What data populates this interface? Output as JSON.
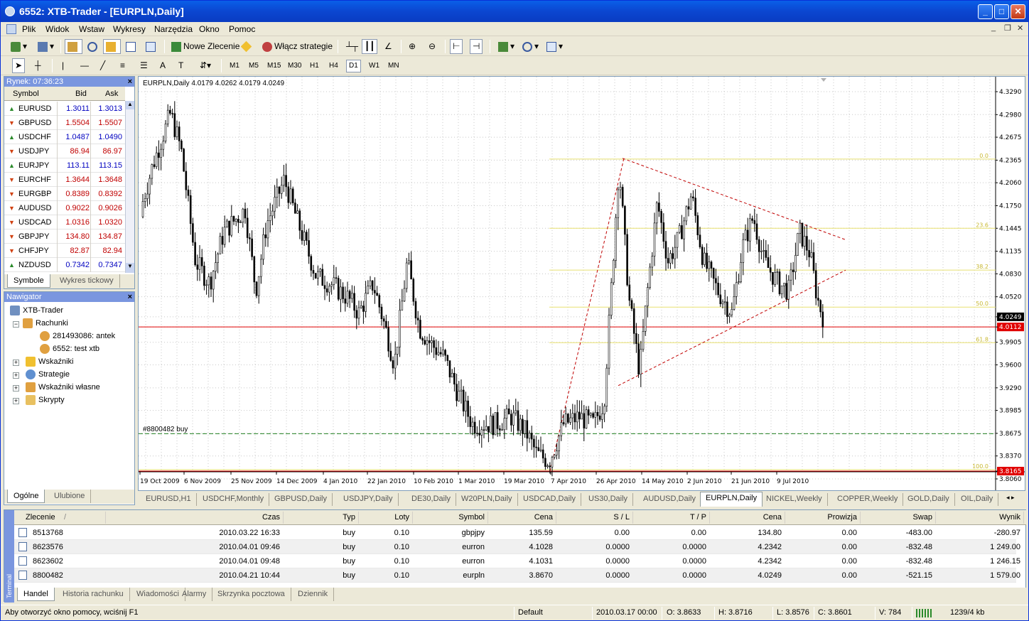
{
  "window": {
    "title": "6552: XTB-Trader - [EURPLN,Daily]"
  },
  "menu": [
    "Plik",
    "Widok",
    "Wstaw",
    "Wykresy",
    "Narzędzia",
    "Okno",
    "Pomoc"
  ],
  "toolbar": {
    "new_order": "Nowe Zlecenie",
    "enable_strategies": "Włącz strategie"
  },
  "timeframes": [
    "M1",
    "M5",
    "M15",
    "M30",
    "H1",
    "H4",
    "D1",
    "W1",
    "MN"
  ],
  "active_timeframe": "D1",
  "market_watch": {
    "title": "Rynek: 07:36:23",
    "col_symbol": "Symbol",
    "col_bid": "Bid",
    "col_ask": "Ask",
    "rows": [
      {
        "symbol": "EURUSD",
        "bid": "1.3011",
        "ask": "1.3013",
        "dir": "up",
        "color": "#0000c0"
      },
      {
        "symbol": "GBPUSD",
        "bid": "1.5504",
        "ask": "1.5507",
        "dir": "down",
        "color": "#c00000"
      },
      {
        "symbol": "USDCHF",
        "bid": "1.0487",
        "ask": "1.0490",
        "dir": "up",
        "color": "#0000c0"
      },
      {
        "symbol": "USDJPY",
        "bid": "86.94",
        "ask": "86.97",
        "dir": "down",
        "color": "#c00000"
      },
      {
        "symbol": "EURJPY",
        "bid": "113.11",
        "ask": "113.15",
        "dir": "up",
        "color": "#0000c0"
      },
      {
        "symbol": "EURCHF",
        "bid": "1.3644",
        "ask": "1.3648",
        "dir": "down",
        "color": "#c00000"
      },
      {
        "symbol": "EURGBP",
        "bid": "0.8389",
        "ask": "0.8392",
        "dir": "down",
        "color": "#c00000"
      },
      {
        "symbol": "AUDUSD",
        "bid": "0.9022",
        "ask": "0.9026",
        "dir": "down",
        "color": "#c00000"
      },
      {
        "symbol": "USDCAD",
        "bid": "1.0316",
        "ask": "1.0320",
        "dir": "down",
        "color": "#c00000"
      },
      {
        "symbol": "GBPJPY",
        "bid": "134.80",
        "ask": "134.87",
        "dir": "down",
        "color": "#c00000"
      },
      {
        "symbol": "CHFJPY",
        "bid": "82.87",
        "ask": "82.94",
        "dir": "down",
        "color": "#c00000"
      },
      {
        "symbol": "NZDUSD",
        "bid": "0.7342",
        "ask": "0.7347",
        "dir": "up",
        "color": "#0000c0"
      }
    ],
    "tabs": [
      "Symbole",
      "Wykres tickowy"
    ]
  },
  "navigator": {
    "title": "Nawigator",
    "root": "XTB-Trader",
    "accounts": "Rachunki",
    "acc1": "281493086: antek",
    "acc2": "6552: test xtb",
    "items": [
      "Wskaźniki",
      "Strategie",
      "Wskaźniki własne",
      "Skrypty"
    ],
    "tabs": [
      "Ogólne",
      "Ulubione"
    ]
  },
  "chart": {
    "header": "EURPLN,Daily  4.0179 4.0262 4.0179 4.0249",
    "order_label": "#8800482 buy",
    "current_price": "4.0249",
    "red_price": "4.0112",
    "low_price": "3.8165",
    "price_ticks": [
      "4.3290",
      "4.2980",
      "4.2675",
      "4.2365",
      "4.2060",
      "4.1750",
      "4.1445",
      "4.1135",
      "4.0830",
      "4.0520",
      "4.0249",
      "4.0112",
      "3.9905",
      "3.9600",
      "3.9290",
      "3.8985",
      "3.8675",
      "3.8370",
      "3.8165",
      "3.8060"
    ],
    "date_ticks": [
      "19 Oct 2009",
      "6 Nov 2009",
      "25 Nov 2009",
      "14 Dec 2009",
      "4 Jan 2010",
      "22 Jan 2010",
      "10 Feb 2010",
      "1 Mar 2010",
      "19 Mar 2010",
      "7 Apr 2010",
      "26 Apr 2010",
      "14 May 2010",
      "2 Jun 2010",
      "21 Jun 2010",
      "9 Jul 2010"
    ],
    "fib_labels": [
      "0.0",
      "23.6",
      "38.2",
      "50.0",
      "61.8",
      "100.0"
    ],
    "colors": {
      "fib": "#e8e070",
      "trend": "#c00000",
      "red_line": "#e00000",
      "order_line": "#208020",
      "candle": "#000000"
    }
  },
  "chart_tabs": [
    "EURUSD,H1",
    "USDCHF,Monthly",
    "GBPUSD,Daily",
    "USDJPY,Daily",
    "DE30,Daily",
    "W20PLN,Daily",
    "USDCAD,Daily",
    "US30,Daily",
    "AUDUSD,Daily",
    "EURPLN,Daily",
    "NICKEL,Weekly",
    "COPPER,Weekly",
    "GOLD,Daily",
    "OIL,Daily"
  ],
  "active_chart_tab": "EURPLN,Daily",
  "terminal": {
    "side_label": "Terminal",
    "headers": [
      "Zlecenie",
      "Czas",
      "Typ",
      "Loty",
      "Symbol",
      "Cena",
      "S / L",
      "T / P",
      "Cena",
      "Prowizja",
      "Swap",
      "Wynik"
    ],
    "sort_mark": "/",
    "rows": [
      [
        "8513768",
        "2010.03.22 16:33",
        "buy",
        "0.10",
        "gbpjpy",
        "135.59",
        "0.00",
        "0.00",
        "134.80",
        "0.00",
        "-483.00",
        "-280.97"
      ],
      [
        "8623576",
        "2010.04.01 09:46",
        "buy",
        "0.10",
        "eurron",
        "4.1028",
        "0.0000",
        "0.0000",
        "4.2342",
        "0.00",
        "-832.48",
        "1 249.00"
      ],
      [
        "8623602",
        "2010.04.01 09:48",
        "buy",
        "0.10",
        "eurron",
        "4.1031",
        "0.0000",
        "0.0000",
        "4.2342",
        "0.00",
        "-832.48",
        "1 246.15"
      ],
      [
        "8800482",
        "2010.04.21 10:44",
        "buy",
        "0.10",
        "eurpln",
        "3.8670",
        "0.0000",
        "0.0000",
        "4.0249",
        "0.00",
        "-521.15",
        "1 579.00"
      ]
    ],
    "tabs": [
      "Handel",
      "Historia rachunku",
      "Wiadomości",
      "Alarmy",
      "Skrzynka pocztowa",
      "Dziennik"
    ]
  },
  "status": {
    "help": "Aby otworzyć okno pomocy, wciśnij F1",
    "profile": "Default",
    "date": "2010.03.17 00:00",
    "open": "O: 3.8633",
    "high": "H: 3.8716",
    "low": "L: 3.8576",
    "close": "C: 3.8601",
    "volume": "V: 784",
    "traffic": "1239/4 kb"
  }
}
